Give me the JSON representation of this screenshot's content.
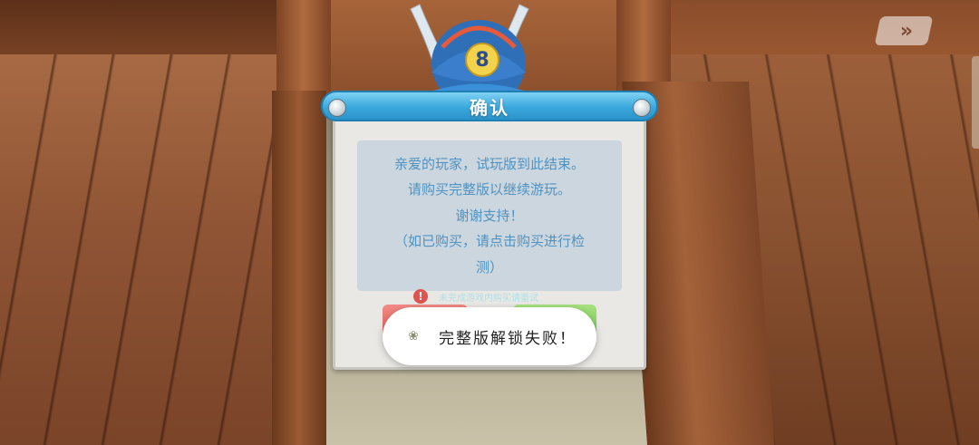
{
  "dialog": {
    "title": "确认",
    "message_lines": [
      "亲爱的玩家，试玩版到此结束。",
      "请购买完整版以继续游玩。",
      "谢谢支持！",
      "（如已购买，请点击购买进行检",
      "测）"
    ],
    "error_text": "未完成游戏内购买请重试"
  },
  "toast": {
    "icon": "flower-icon",
    "text": "完整版解锁失败！"
  },
  "skip_button": {
    "icon": "fast-forward-icon",
    "glyph": "»"
  },
  "colors": {
    "title_bar": "#3aa8dd",
    "message_text": "#4f93c2",
    "message_bg": "#ccd6de",
    "cancel_button": "#e05a55",
    "confirm_button": "#6cc34b"
  }
}
